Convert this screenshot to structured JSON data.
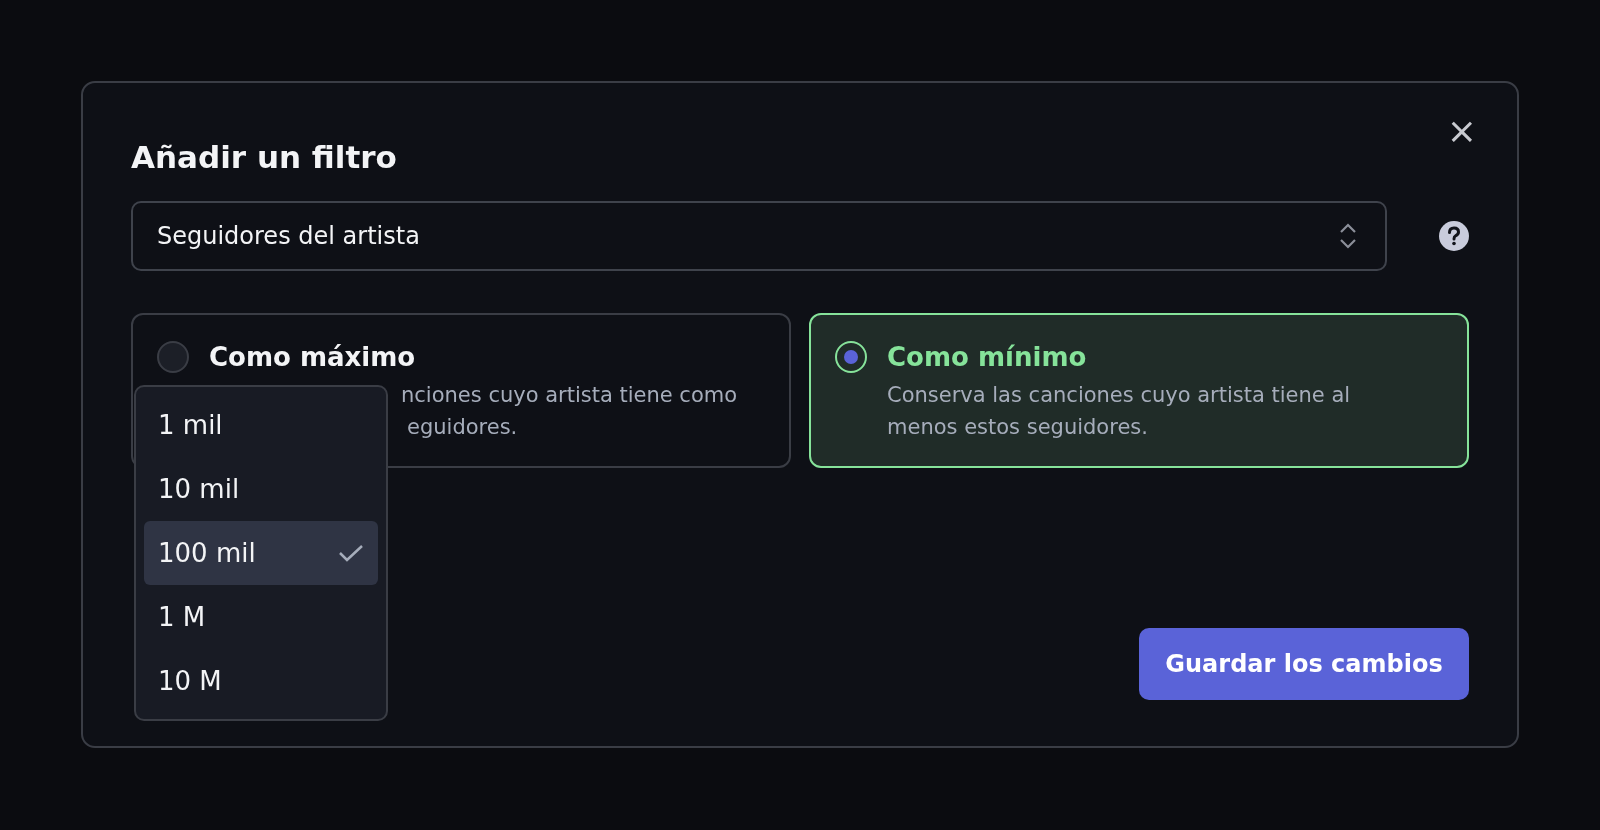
{
  "dialog": {
    "title": "Añadir un filtro",
    "close_icon": "×"
  },
  "field_select": {
    "value": "Seguidores del artista"
  },
  "options": [
    {
      "title": "Como máximo",
      "description_lines": [
        "nciones cuyo artista tiene como",
        "eguidores."
      ],
      "selected": false
    },
    {
      "title": "Como mínimo",
      "description_lines": [
        "Conserva las canciones cuyo artista tiene al",
        "menos estos seguidores."
      ],
      "selected": true
    }
  ],
  "value_dropdown": {
    "open": true,
    "items": [
      {
        "label": "1 mil",
        "selected": false
      },
      {
        "label": "10 mil",
        "selected": false
      },
      {
        "label": "100 mil",
        "selected": true
      },
      {
        "label": "1 M",
        "selected": false
      },
      {
        "label": "10 M",
        "selected": false
      }
    ]
  },
  "save_button": {
    "label": "Guardar los cambios"
  }
}
